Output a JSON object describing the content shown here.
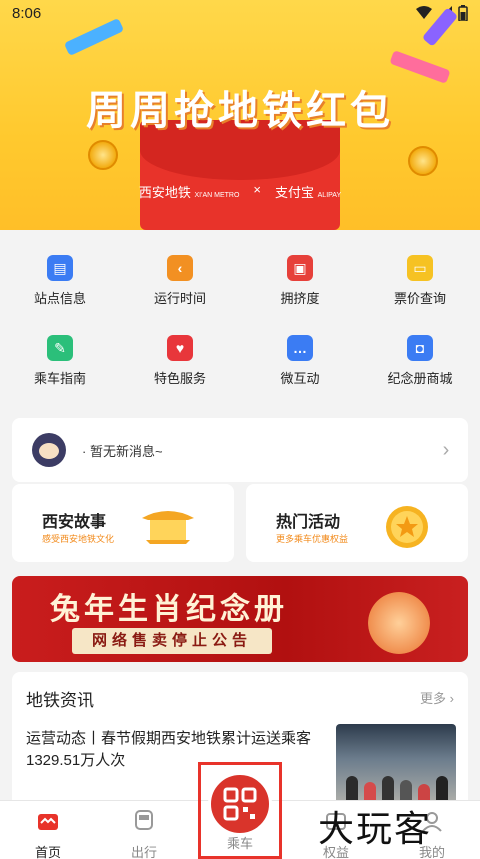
{
  "status_bar": {
    "time": "8:06"
  },
  "banner": {
    "title": "周周抢地铁红包",
    "logo_left": "西安地铁",
    "logo_left_sub": "XI'AN METRO",
    "separator": "×",
    "logo_right": "支付宝",
    "logo_right_sub": "ALIPAY"
  },
  "grid": [
    {
      "label": "站点信息",
      "icon": "station-icon",
      "color": "#3b7cf3"
    },
    {
      "label": "运行时间",
      "icon": "clock-icon",
      "color": "#f29022"
    },
    {
      "label": "拥挤度",
      "icon": "bus-icon",
      "color": "#e6403a"
    },
    {
      "label": "票价查询",
      "icon": "ticket-icon",
      "color": "#f6c223"
    },
    {
      "label": "乘车指南",
      "icon": "guide-icon",
      "color": "#2bbf7a"
    },
    {
      "label": "特色服务",
      "icon": "heart-icon",
      "color": "#e8363b"
    },
    {
      "label": "微互动",
      "icon": "chat-icon",
      "color": "#3b7cf3"
    },
    {
      "label": "纪念册商城",
      "icon": "bag-icon",
      "color": "#3b7cf3"
    }
  ],
  "notice": {
    "text": "· 暂无新消息~"
  },
  "cards": [
    {
      "title": "西安故事",
      "subtitle": "感受西安地铁文化"
    },
    {
      "title": "热门活动",
      "subtitle": "更多乘车优惠权益"
    }
  ],
  "promo": {
    "title": "兔年生肖纪念册",
    "subtitle": "网络售卖停止公告"
  },
  "news": {
    "heading": "地铁资讯",
    "more": "更多",
    "article": "运营动态丨春节假期西安地铁累计运送乘客1329.51万人次"
  },
  "tabbar": [
    {
      "label": "首页",
      "icon": "home-icon"
    },
    {
      "label": "出行",
      "icon": "train-icon"
    },
    {
      "label": "乘车",
      "icon": "qr-code-icon"
    },
    {
      "label": "权益",
      "icon": "wallet-icon"
    },
    {
      "label": "我的",
      "icon": "profile-icon"
    }
  ],
  "watermark": "大玩客",
  "colors": {
    "accent": "#e8332a",
    "active_tab": "#e8332a",
    "inactive_tab": "#888888"
  }
}
